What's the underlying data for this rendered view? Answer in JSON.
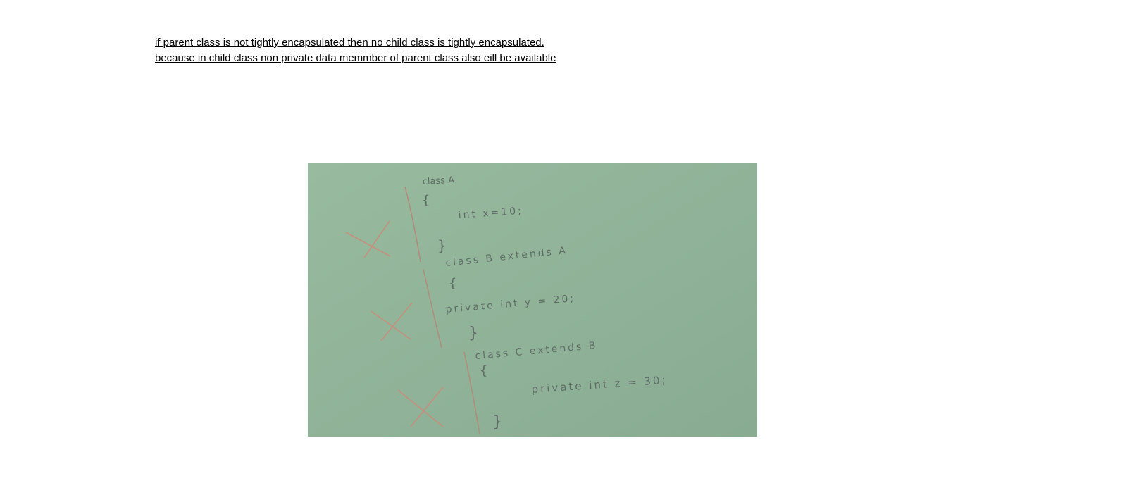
{
  "notes": {
    "line1": "if parent class is not tightly encapsulated then no child class is tightly encapsulated.",
    "line2": "because in child class non private data memmber of parent class also eill be available"
  },
  "board": {
    "colors": {
      "background": "#93b79b",
      "chalk": "#5f6d66",
      "cross": "#c58f7c",
      "bracket": "#b08c7c"
    },
    "blocks": [
      {
        "header": "class A",
        "open_brace": "{",
        "body": "int x=10;",
        "close_brace": "}"
      },
      {
        "header": "class B extends A",
        "open_brace": "{",
        "body": "private int y = 20;",
        "close_brace": "}"
      },
      {
        "header": "class C extends B",
        "open_brace": "{",
        "body": "private int z = 30;",
        "close_brace": "}"
      }
    ]
  }
}
